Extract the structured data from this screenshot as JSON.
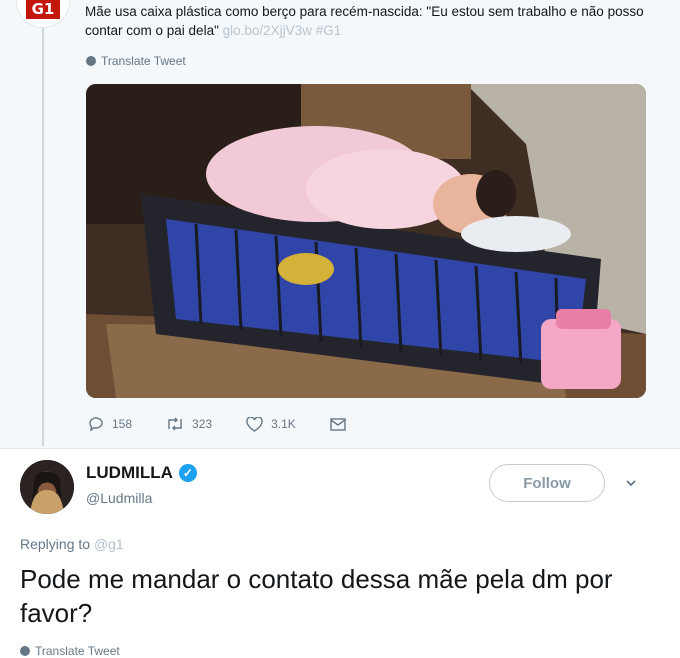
{
  "original_tweet": {
    "text": "Mãe usa caixa plástica como berço para recém-nascida: \"Eu estou sem trabalho e não posso contar com o pai dela\"",
    "link": "glo.bo/2XjjV3w #G1",
    "translate_label": "Translate Tweet",
    "logo_text": "G1",
    "stats": {
      "replies": "158",
      "retweets": "323",
      "likes": "3.1K"
    }
  },
  "reply": {
    "name": "LUDMILLA",
    "handle": "@Ludmilla",
    "follow_label": "Follow",
    "replying_prefix": "Replying to",
    "replying_to": "@g1",
    "text": "Pode me mandar o contato dessa mãe pela dm por favor?",
    "translate_label": "Translate Tweet"
  },
  "colors": {
    "accent": "#1da1f2",
    "g1_red": "#c4170c",
    "muted": "#657786"
  }
}
